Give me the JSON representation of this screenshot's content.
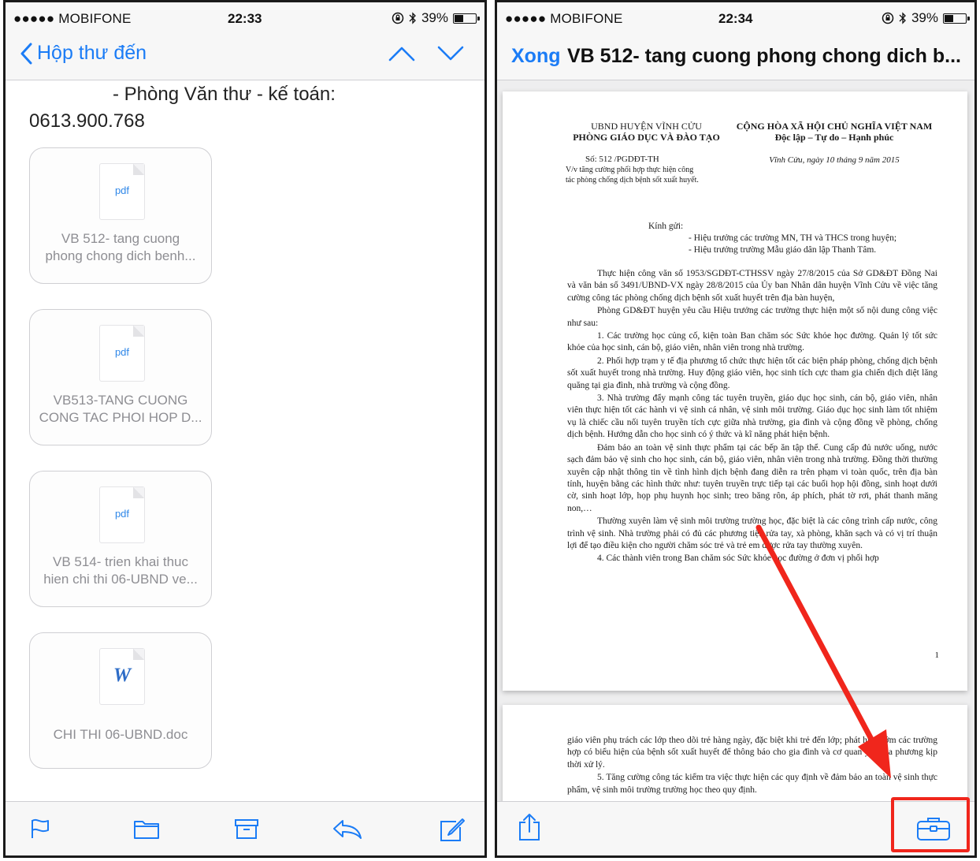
{
  "status_left": {
    "carrier": "●●●●● MOBIFONE",
    "time": "22:33",
    "battery": "39%",
    "battery_level": 0.39
  },
  "status_right": {
    "carrier": "●●●●● MOBIFONE",
    "time": "22:34",
    "battery": "39%",
    "battery_level": 0.39
  },
  "mail": {
    "back_label": "Hộp thư đến",
    "contact_line": "- Phòng Văn thư - kế toán:",
    "phone_line": "0613.900.768",
    "attachments": [
      {
        "type": "pdf",
        "line1": "VB 512- tang cuong",
        "line2": "phong chong  dich benh..."
      },
      {
        "type": "pdf",
        "line1": "VB513-TANG CUONG",
        "line2": "CONG TAC PHOI HOP D..."
      },
      {
        "type": "pdf",
        "line1": "VB 514- trien khai thuc",
        "line2": "hien chi thi 06-UBND ve..."
      },
      {
        "type": "W",
        "line1": "CHI THI 06-UBND.doc",
        "line2": ""
      }
    ]
  },
  "viewer": {
    "done_label": "Xong",
    "title": "VB 512- tang cuong phong chong  dich b...",
    "doc": {
      "org1": "UBND HUYỆN VĨNH CỬU",
      "org2": "PHÒNG GIÁO DỤC VÀ ĐÀO TẠO",
      "nation1": "CỘNG HÒA XÃ HỘI CHỦ NGHĨA VIỆT NAM",
      "nation2": "Độc lập – Tự do – Hạnh phúc",
      "number": "Số: 512 /PGDĐT-TH",
      "subject1": "V/v tăng cường phối hợp thực hiện công",
      "subject2": "tác phòng chống dịch bệnh  sốt xuất huyết.",
      "place_date": "Vĩnh Cửu, ngày  10  tháng 9 năm 2015",
      "greeting": "Kính gửi:",
      "recipient1": "- Hiệu trưởng các trường MN, TH và THCS trong huyện;",
      "recipient2": "- Hiệu trưởng trường Mẫu giáo dân lập Thanh Tâm.",
      "paragraphs": [
        "Thực hiện công văn số 1953/SGDĐT-CTHSSV ngày 27/8/2015 của Sở GD&ĐT Đồng Nai và văn bản số 3491/UBND-VX ngày 28/8/2015 của Ủy ban Nhân dân huyện Vĩnh Cửu về việc tăng cường công tác phòng chống dịch bệnh sốt xuất huyết trên địa bàn huyện,",
        "Phòng GD&ĐT huyện yêu cầu Hiệu trưởng các trường thực hiện một số nội dung công việc như sau:",
        "1. Các trường học củng cố, kiện toàn Ban chăm sóc Sức khỏe học đường. Quản lý tốt sức khỏe của học sinh, cán bộ, giáo viên, nhân viên trong nhà trường.",
        "2. Phối hợp trạm y tế địa phương tổ chức thực hiện tốt các biện pháp phòng, chống dịch bệnh sốt xuất huyết trong nhà trường. Huy động giáo viên, học sinh tích cực tham gia chiến dịch diệt lăng quăng tại gia đình, nhà trường và cộng đồng.",
        "3. Nhà trường đẩy mạnh công tác tuyên truyền, giáo dục học sinh, cán bộ, giáo viên, nhân viên thực hiện tốt các hành vi vệ sinh cá nhân, vệ sinh môi trường. Giáo dục học sinh làm tốt nhiệm vụ là chiếc cầu nối tuyên truyền tích cực giữa nhà trường, gia đình và cộng đồng về phòng, chống dịch bệnh. Hướng dẫn cho học sinh có ý thức và kĩ năng phát hiện bệnh.",
        "Đảm bảo an toàn vệ sinh thực phẩm tại các bếp ăn tập thể. Cung cấp đủ nước uống, nước sạch đảm bảo vệ sinh cho học sinh, cán bộ, giáo viên, nhân viên trong nhà trường. Đồng thời thường xuyên cập nhật thông tin về tình hình dịch bệnh đang diễn ra trên phạm vi toàn quốc, trên địa bàn tỉnh, huyện bằng các hình thức như: tuyên truyền trực tiếp tại các buổi họp hội đồng, sinh hoạt dưới cờ, sinh hoạt lớp, họp phụ huynh học sinh; treo băng rôn, áp phích, phát tờ rơi, phát thanh măng non,…",
        "Thường xuyên làm vệ sinh môi trường trường học, đặc biệt là các công trình cấp nước, công trình vệ sinh. Nhà trường phải có đủ các phương tiện rửa tay, xà phòng, khăn sạch và có vị trí thuận lợi để tạo điều kiện cho người chăm sóc trẻ và trẻ em được rửa tay thường xuyên.",
        "4. Các thành viên trong Ban chăm sóc Sức khỏe học đường ở đơn vị phối hợp"
      ],
      "page_number": "1",
      "page2_paragraphs": [
        "giáo viên phụ trách các lớp theo dõi trẻ hàng ngày, đặc biệt khi trẻ đến lớp; phát hiện sớm các trường hợp có biểu hiện của bệnh sốt xuất huyết để thông báo cho gia đình và cơ quan y tế địa phương kịp thời xử lý.",
        "5. Tăng cường công tác kiểm tra việc thực hiện các quy định về đảm bảo an toàn vệ sinh thực phẩm, vệ sinh môi trường trường học theo quy định."
      ]
    }
  },
  "colors": {
    "ios_blue": "#1b7cf6",
    "annotation_red": "#f0261c"
  }
}
